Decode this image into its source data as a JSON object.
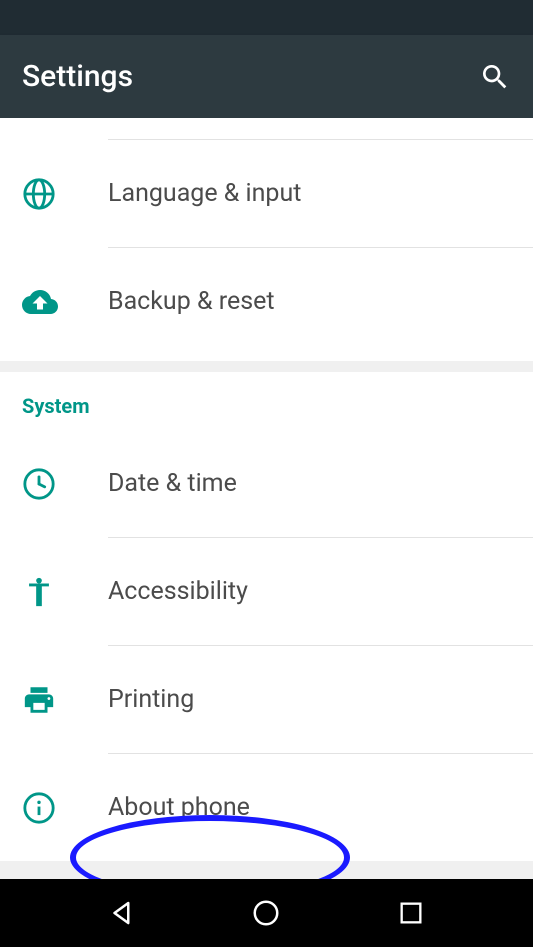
{
  "header": {
    "title": "Settings"
  },
  "accent_color": "#009688",
  "sections": [
    {
      "id": "personal",
      "header": null,
      "items": [
        {
          "id": "language_input",
          "label": "Language & input",
          "icon": "globe-icon"
        },
        {
          "id": "backup_reset",
          "label": "Backup & reset",
          "icon": "cloud-upload-icon"
        }
      ]
    },
    {
      "id": "system",
      "header": "System",
      "items": [
        {
          "id": "date_time",
          "label": "Date & time",
          "icon": "clock-icon"
        },
        {
          "id": "accessibility",
          "label": "Accessibility",
          "icon": "accessibility-icon"
        },
        {
          "id": "printing",
          "label": "Printing",
          "icon": "printer-icon"
        },
        {
          "id": "about_phone",
          "label": "About phone",
          "icon": "info-icon"
        }
      ]
    }
  ],
  "annotation": {
    "target": "about_phone",
    "shape": "ellipse",
    "color": "#1a1aff"
  }
}
